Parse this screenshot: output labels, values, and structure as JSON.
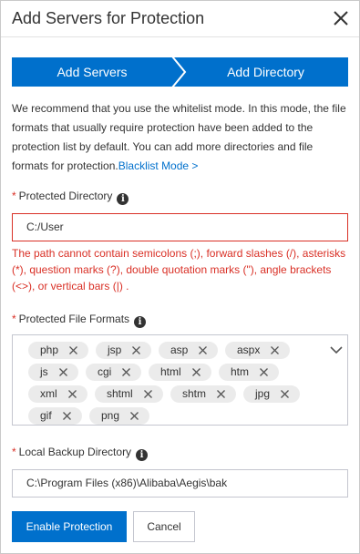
{
  "dialog": {
    "title": "Add Servers for Protection",
    "close_icon": "close-icon"
  },
  "steps": [
    {
      "label": "Add Servers"
    },
    {
      "label": "Add Directory"
    }
  ],
  "intro": {
    "text": "We recommend that you use the whitelist mode. In this mode, the file formats that usually require protection have been added to the protection list by default. You can add more directories and file formats for protection.",
    "link": "Blacklist Mode >"
  },
  "protected_directory": {
    "required_mark": "*",
    "label": "Protected Directory",
    "info_icon": "info-icon",
    "value": "C:/User",
    "error": "The path cannot contain semicolons (;), forward slashes (/), asterisks (*), question marks (?), double quotation marks (\"), angle brackets (<>), or vertical bars (|) ."
  },
  "file_formats": {
    "required_mark": "*",
    "label": "Protected File Formats",
    "info_icon": "info-icon",
    "tags": [
      "php",
      "jsp",
      "asp",
      "aspx",
      "js",
      "cgi",
      "html",
      "htm",
      "xml",
      "shtml",
      "shtm",
      "jpg",
      "gif",
      "png"
    ],
    "dropdown_icon": "chevron-down-icon"
  },
  "backup_directory": {
    "required_mark": "*",
    "label": "Local Backup Directory",
    "info_icon": "info-icon",
    "value": "C:\\Program Files (x86)\\Alibaba\\Aegis\\bak"
  },
  "actions": {
    "enable_label": "Enable Protection",
    "cancel_label": "Cancel"
  },
  "colors": {
    "accent": "#0070cc",
    "error": "#d93026",
    "tag_bg": "#ebebeb"
  }
}
